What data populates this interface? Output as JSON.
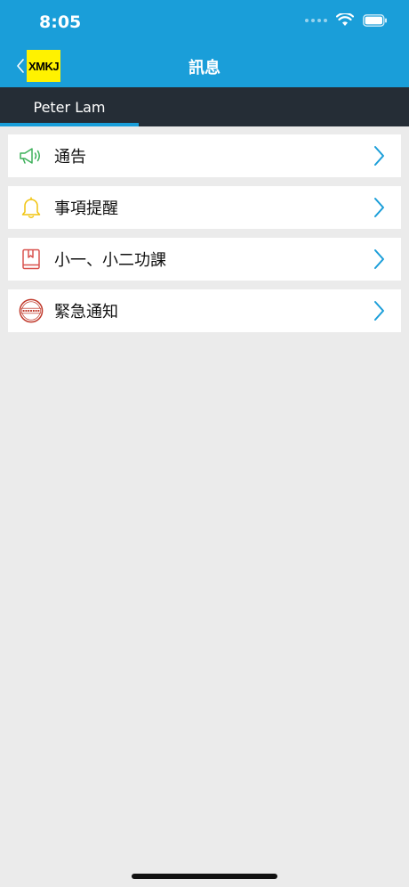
{
  "status_bar": {
    "time": "8:05"
  },
  "header": {
    "title": "訊息",
    "logo_text": "XMKJ"
  },
  "tabs": [
    {
      "label": "Peter Lam"
    }
  ],
  "menu": {
    "items": [
      {
        "label": "通告",
        "icon": "megaphone-icon"
      },
      {
        "label": "事項提醒",
        "icon": "bell-icon"
      },
      {
        "label": "小一、小二功課",
        "icon": "book-icon"
      },
      {
        "label": "緊急通知",
        "icon": "urgent-stamp-icon"
      }
    ]
  },
  "colors": {
    "header": "#1a9ed9",
    "tabbar": "#252d36",
    "accent": "#1a9ed9",
    "background": "#ebebeb"
  }
}
